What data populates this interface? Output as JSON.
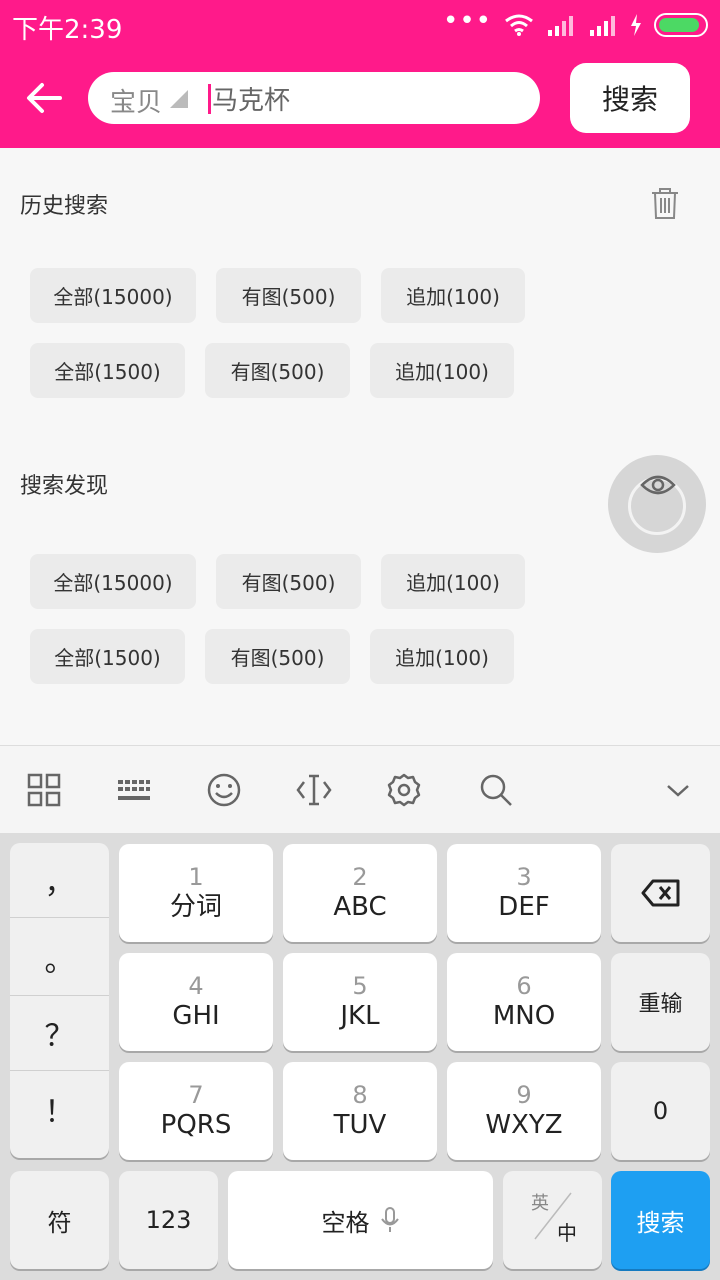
{
  "status_bar": {
    "time": "下午2:39"
  },
  "header": {
    "search_scope": "宝贝",
    "search_query": "马克杯",
    "search_button": "搜索",
    "accent_color": "#ff1a8a"
  },
  "history": {
    "title": "历史搜索",
    "tags": [
      "全部(15000)",
      "有图(500)",
      "追加(100)",
      "全部(1500)",
      "有图(500)",
      "追加(100)"
    ]
  },
  "discover": {
    "title": "搜索发现",
    "tags": [
      "全部(15000)",
      "有图(500)",
      "追加(100)",
      "全部(1500)",
      "有图(500)",
      "追加(100)"
    ]
  },
  "keyboard": {
    "toolbar_icons": [
      "grid-icon",
      "keyboard-icon",
      "emoji-icon",
      "cursor-icon",
      "settings-icon",
      "search-icon",
      "chevron-down-icon"
    ],
    "punctuation": [
      "，",
      "。",
      "？",
      "！"
    ],
    "keys": [
      {
        "num": "1",
        "letters": "分词"
      },
      {
        "num": "2",
        "letters": "ABC"
      },
      {
        "num": "3",
        "letters": "DEF"
      },
      {
        "num": "4",
        "letters": "GHI"
      },
      {
        "num": "5",
        "letters": "JKL"
      },
      {
        "num": "6",
        "letters": "MNO"
      },
      {
        "num": "7",
        "letters": "PQRS"
      },
      {
        "num": "8",
        "letters": "TUV"
      },
      {
        "num": "9",
        "letters": "WXYZ"
      }
    ],
    "reenter": "重输",
    "zero": "0",
    "symbols": "符",
    "numbers": "123",
    "space": "空格",
    "lang_en": "英",
    "lang_zh": "中",
    "search": "搜索",
    "search_color": "#1e9ff2"
  }
}
